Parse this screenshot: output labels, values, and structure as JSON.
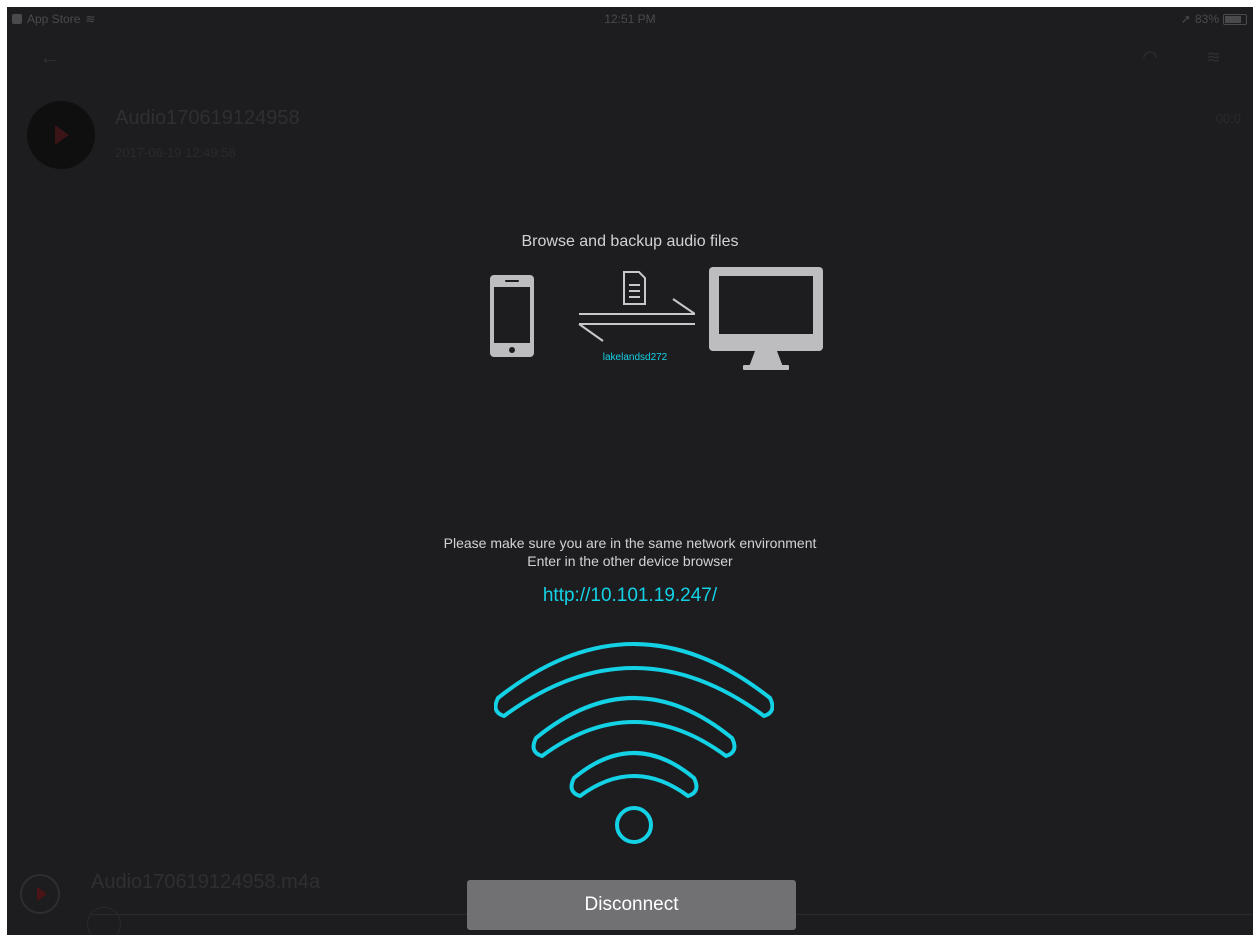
{
  "status_bar": {
    "app_label": "App Store",
    "time": "12:51 PM",
    "battery": "83%"
  },
  "background_list": {
    "row_title": "Audio170619124958",
    "row_subtitle": "2017-06-19 12:49:58",
    "row_time": "00:0"
  },
  "player": {
    "track_name": "Audio170619124958.m4a"
  },
  "transfer": {
    "headline": "Browse and backup audio files",
    "device_name": "lakelandsd272",
    "instruction_line1": "Please make sure you are in the same network environment",
    "instruction_line2": "Enter in the other device browser",
    "url": "http://10.101.19.247/"
  },
  "actions": {
    "disconnect_label": "Disconnect"
  },
  "colors": {
    "accent": "#14d2e6",
    "background": "#1d1d1f",
    "button": "#717173"
  },
  "icons": [
    "phone-icon",
    "document-icon",
    "transfer-arrows-icon",
    "monitor-icon",
    "wifi-icon",
    "back-icon",
    "play-icon"
  ]
}
